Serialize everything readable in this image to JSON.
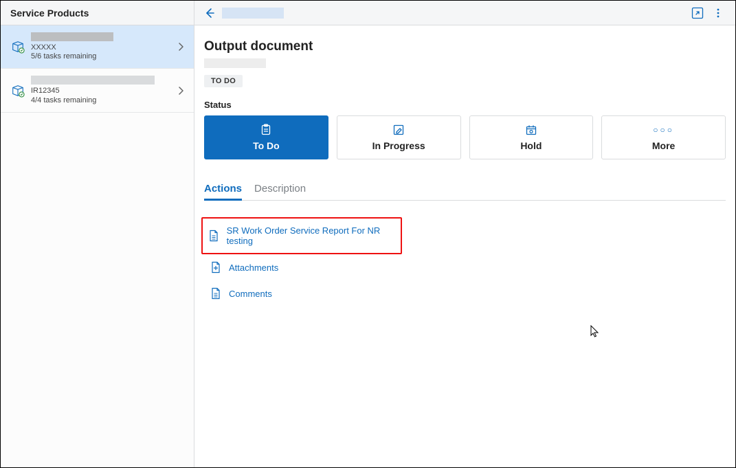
{
  "header": {
    "title": "Service Products"
  },
  "sidebar": {
    "items": [
      {
        "code": "XXXXX",
        "sub": "5/6 tasks remaining",
        "selected": true
      },
      {
        "code": "IR12345",
        "sub": "4/4 tasks remaining",
        "selected": false
      }
    ]
  },
  "detail": {
    "title": "Output document",
    "state_badge": "TO DO",
    "status_label": "Status",
    "status_options": {
      "todo": "To Do",
      "in_progress": "In Progress",
      "hold": "Hold",
      "more": "More"
    },
    "tabs": {
      "actions": "Actions",
      "description": "Description"
    },
    "actions": {
      "report": "SR Work Order Service Report For NR testing",
      "attachments": "Attachments",
      "comments": "Comments"
    }
  }
}
